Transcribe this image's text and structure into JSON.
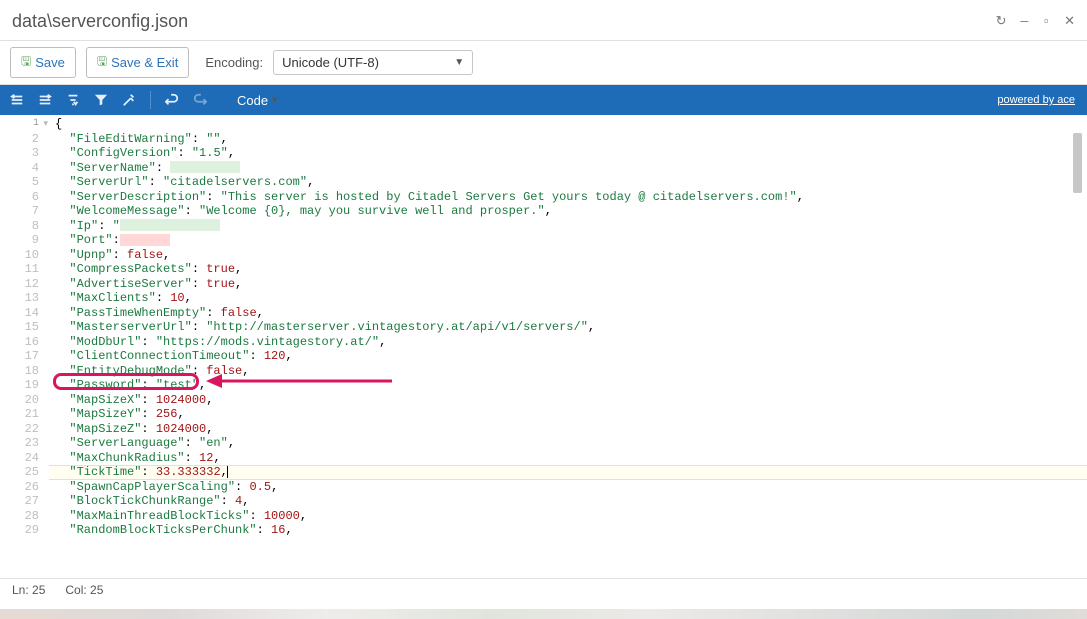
{
  "title": "data\\serverconfig.json",
  "toolbar": {
    "save": "Save",
    "save_exit": "Save & Exit",
    "encoding_label": "Encoding:",
    "encoding_value": "Unicode (UTF-8)"
  },
  "editor_toolbar": {
    "mode": "Code",
    "powered_by": "powered by ace"
  },
  "status": {
    "line": "Ln: 25",
    "col": "Col: 25"
  },
  "code": {
    "l1": "{",
    "l2_key": "\"FileEditWarning\"",
    "l2_val": "\"\"",
    "l3_key": "\"ConfigVersion\"",
    "l3_val": "\"1.5\"",
    "l4_key": "\"ServerName\"",
    "l5_key": "\"ServerUrl\"",
    "l5_val": "\"citadelservers.com\"",
    "l6_key": "\"ServerDescription\"",
    "l6_val": "\"This server is hosted by Citadel Servers Get yours today @ citadelservers.com!\"",
    "l7_key": "\"WelcomeMessage\"",
    "l7_val": "\"Welcome {0}, may you survive well and prosper.\"",
    "l8_key": "\"Ip\"",
    "l9_key": "\"Port\"",
    "l10_key": "\"Upnp\"",
    "l10_val": "false",
    "l11_key": "\"CompressPackets\"",
    "l11_val": "true",
    "l12_key": "\"AdvertiseServer\"",
    "l12_val": "true",
    "l13_key": "\"MaxClients\"",
    "l13_val": "10",
    "l14_key": "\"PassTimeWhenEmpty\"",
    "l14_val": "false",
    "l15_key": "\"MasterserverUrl\"",
    "l15_val": "\"http://masterserver.vintagestory.at/api/v1/servers/\"",
    "l16_key": "\"ModDbUrl\"",
    "l16_val": "\"https://mods.vintagestory.at/\"",
    "l17_key": "\"ClientConnectionTimeout\"",
    "l17_val": "120",
    "l18_key": "\"EntityDebugMode\"",
    "l18_val": "false",
    "l19_key": "\"Password\"",
    "l19_val": "\"test\"",
    "l20_key": "\"MapSizeX\"",
    "l20_val": "1024000",
    "l21_key": "\"MapSizeY\"",
    "l21_val": "256",
    "l22_key": "\"MapSizeZ\"",
    "l22_val": "1024000",
    "l23_key": "\"ServerLanguage\"",
    "l23_val": "\"en\"",
    "l24_key": "\"MaxChunkRadius\"",
    "l24_val": "12",
    "l25_key": "\"TickTime\"",
    "l25_val": "33.333332",
    "l26_key": "\"SpawnCapPlayerScaling\"",
    "l26_val": "0.5",
    "l27_key": "\"BlockTickChunkRange\"",
    "l27_val": "4",
    "l28_key": "\"MaxMainThreadBlockTicks\"",
    "l28_val": "10000",
    "l29_key": "\"RandomBlockTicksPerChunk\"",
    "l29_val": "16"
  },
  "lines": [
    "1",
    "2",
    "3",
    "4",
    "5",
    "6",
    "7",
    "8",
    "9",
    "10",
    "11",
    "12",
    "13",
    "14",
    "15",
    "16",
    "17",
    "18",
    "19",
    "20",
    "21",
    "22",
    "23",
    "24",
    "25",
    "26",
    "27",
    "28",
    "29"
  ]
}
